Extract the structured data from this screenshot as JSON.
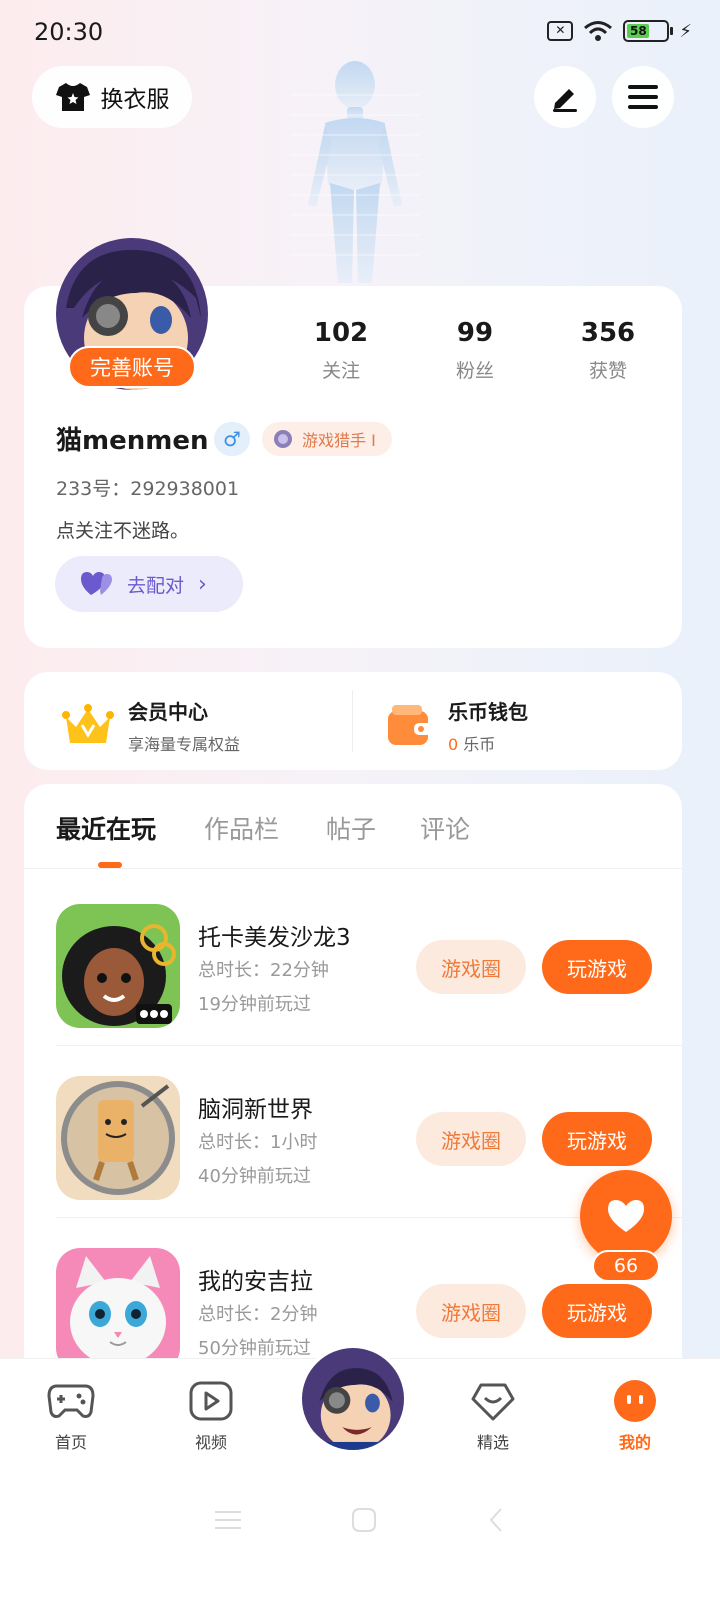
{
  "status_bar": {
    "time": "20:30",
    "battery": "58"
  },
  "header": {
    "outfit_button": "换衣服"
  },
  "profile": {
    "complete_badge": "完善账号",
    "stats": [
      {
        "num": "102",
        "label": "关注"
      },
      {
        "num": "99",
        "label": "粉丝"
      },
      {
        "num": "356",
        "label": "获赞"
      }
    ],
    "username": "猫menmen",
    "gender_symbol": "♂",
    "title_badge": "游戏猎手 I",
    "user_id": "233号：292938001",
    "bio": "点关注不迷路。",
    "match_button": "去配对"
  },
  "wallet": {
    "vip": {
      "title": "会员中心",
      "sub": "享海量专属权益"
    },
    "coins": {
      "title": "乐币钱包",
      "amount": "0",
      "unit": "乐币"
    }
  },
  "tabs": [
    "最近在玩",
    "作品栏",
    "帖子",
    "评论"
  ],
  "games": [
    {
      "name": "托卡美发沙龙3",
      "duration": "总时长：22分钟",
      "last_played": "19分钟前玩过",
      "circle_label": "游戏圈",
      "play_label": "玩游戏"
    },
    {
      "name": "脑洞新世界",
      "duration": "总时长：1小时",
      "last_played": "40分钟前玩过",
      "circle_label": "游戏圈",
      "play_label": "玩游戏"
    },
    {
      "name": "我的安吉拉",
      "duration": "总时长：2分钟",
      "last_played": "50分钟前玩过",
      "circle_label": "游戏圈",
      "play_label": "玩游戏"
    }
  ],
  "fab": {
    "count": "66"
  },
  "bottom_nav": [
    {
      "label": "首页"
    },
    {
      "label": "视频"
    },
    {
      "label": "精选"
    },
    {
      "label": "我的"
    }
  ],
  "colors": {
    "accent": "#ff6a1a",
    "match": "#6a5acd",
    "male": "#3f8fe0"
  }
}
